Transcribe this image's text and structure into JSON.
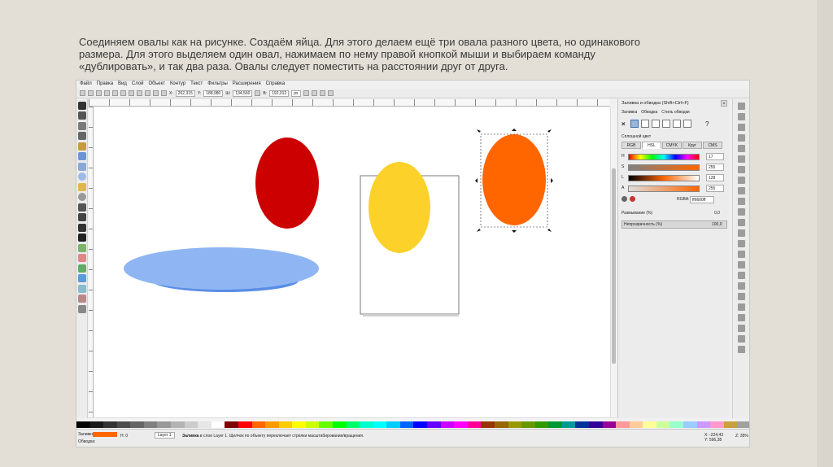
{
  "slide": {
    "caption_lines": [
      "Соединяем овалы как на рисунке. Создаём яйца. Для этого делаем ещё три овала разного цвета, но одинакового",
      "размера. Для этого выделяем один овал, нажимаем по нему правой кнопкой мыши и выбираем команду",
      "«дублировать», и так два раза. Овалы следует поместить на расстоянии друг от друга."
    ]
  },
  "menu": [
    "Файл",
    "Правка",
    "Вид",
    "Слой",
    "Объект",
    "Контур",
    "Текст",
    "Фильтры",
    "Расширения",
    "Справка"
  ],
  "toolbar": {
    "x_label": "X:",
    "x_value": "262,315",
    "y_label": "Y:",
    "y_value": "188,980",
    "w_label": "Ш:",
    "w_value": "134,560",
    "h_label": "В:",
    "h_value": "192,012",
    "unit": "px"
  },
  "canvas": {
    "colors": {
      "red": "#cc0000",
      "yellow": "#fcd12a",
      "orange": "#ff6600",
      "plate_light": "#8fb6f2",
      "plate_dark": "#5a8de6"
    }
  },
  "dialog": {
    "title": "Заливка и обводка (Shift+Ctrl+F)",
    "close": "×",
    "tabs": [
      "Заливка",
      "Обводка",
      "Стиль обводки"
    ],
    "solid_label": "Сплошной цвет",
    "modes": [
      "RGB",
      "HSL",
      "CMYK",
      "Круг",
      "CMS"
    ],
    "active_mode": "HSL",
    "sliders": [
      {
        "label": "H",
        "value": "17"
      },
      {
        "label": "S",
        "value": "255"
      },
      {
        "label": "L",
        "value": "128"
      },
      {
        "label": "A",
        "value": "255"
      }
    ],
    "rgba_label": "RGBA:",
    "rgba_value": "ff6600ff",
    "blur_label": "Размывание (%)",
    "blur_value": "0,0",
    "opacity_label": "Непрозрачность (%)",
    "opacity_value": "100,0"
  },
  "status": {
    "fill_label": "Заливка:",
    "stroke_label": "Обводка:",
    "fill_color": "#ff6600",
    "opacity_label": "Н:",
    "opacity_value": "0",
    "layer": "Layer 1",
    "message_bold": "Заливка",
    "message": " в слое Layer 1. Щелчок по объекту переключает стрелки масштабирования/вращения.",
    "x_label": "X:",
    "x_value": "-224,43",
    "y_label": "Y:",
    "y_value": "596,38",
    "zoom_label": "Z:",
    "zoom_value": "35%"
  },
  "palette_colors": [
    "#000000",
    "#1a1a1a",
    "#333333",
    "#4d4d4d",
    "#666666",
    "#808080",
    "#999999",
    "#b3b3b3",
    "#cccccc",
    "#e6e6e6",
    "#ffffff",
    "#800000",
    "#ff0000",
    "#ff6600",
    "#ff9900",
    "#ffcc00",
    "#ffff00",
    "#ccff00",
    "#66ff00",
    "#00ff00",
    "#00ff66",
    "#00ffcc",
    "#00ffff",
    "#00ccff",
    "#0066ff",
    "#0000ff",
    "#6600ff",
    "#cc00ff",
    "#ff00ff",
    "#ff0099",
    "#993300",
    "#996600",
    "#999900",
    "#669900",
    "#339900",
    "#009933",
    "#009999",
    "#003399",
    "#330099",
    "#990099",
    "#ff9999",
    "#ffcc99",
    "#ffff99",
    "#ccff99",
    "#99ffcc",
    "#99ccff",
    "#cc99ff",
    "#ff99cc",
    "#c8a040",
    "#a0a0a0"
  ]
}
